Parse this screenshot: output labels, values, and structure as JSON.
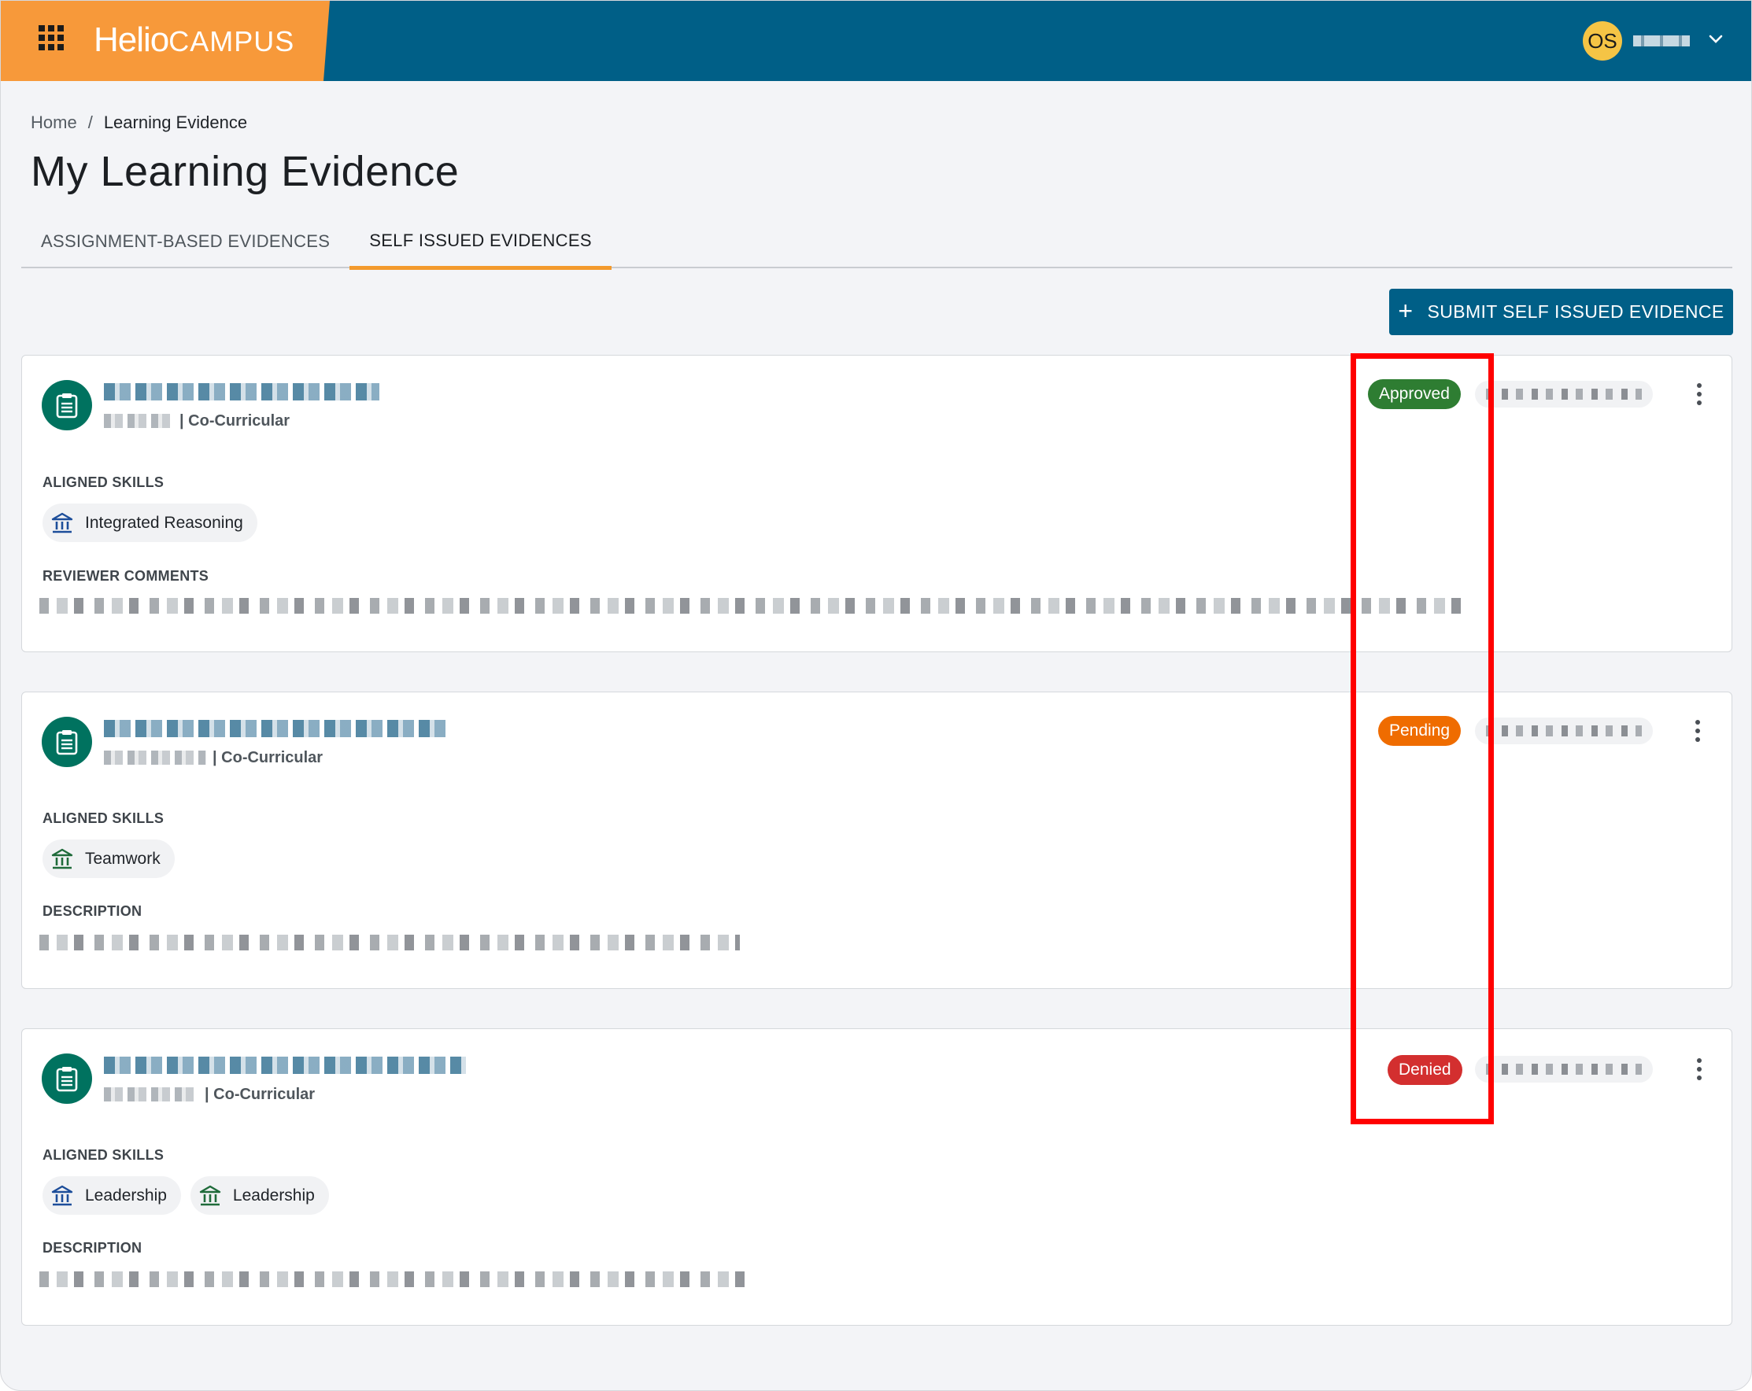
{
  "header": {
    "logo_part1": "Helio",
    "logo_part2": "CAMPUS",
    "avatar_initials": "OS",
    "colors": {
      "bar": "#005f87",
      "brand": "#f7993a",
      "avatar": "#f5c445"
    }
  },
  "breadcrumb": {
    "home": "Home",
    "separator": "/",
    "current": "Learning Evidence"
  },
  "page": {
    "title": "My Learning Evidence"
  },
  "tabs": [
    {
      "label": "ASSIGNMENT-BASED EVIDENCES",
      "active": false
    },
    {
      "label": "SELF ISSUED EVIDENCES",
      "active": true
    }
  ],
  "actions": {
    "submit_label": "SUBMIT SELF ISSUED EVIDENCE"
  },
  "cards": [
    {
      "category": "| Co-Curricular",
      "skills_label": "ALIGNED SKILLS",
      "skills": [
        "Integrated Reasoning"
      ],
      "section_label": "REVIEWER COMMENTS",
      "status": "Approved",
      "status_color": "#2e7d32"
    },
    {
      "category": "| Co-Curricular",
      "skills_label": "ALIGNED SKILLS",
      "skills": [
        "Teamwork"
      ],
      "section_label": "DESCRIPTION",
      "status": "Pending",
      "status_color": "#ef6c00"
    },
    {
      "category": "| Co-Curricular",
      "skills_label": "ALIGNED SKILLS",
      "skills": [
        "Leadership",
        "Leadership"
      ],
      "section_label": "DESCRIPTION",
      "status": "Denied",
      "status_color": "#d32f2f"
    }
  ]
}
